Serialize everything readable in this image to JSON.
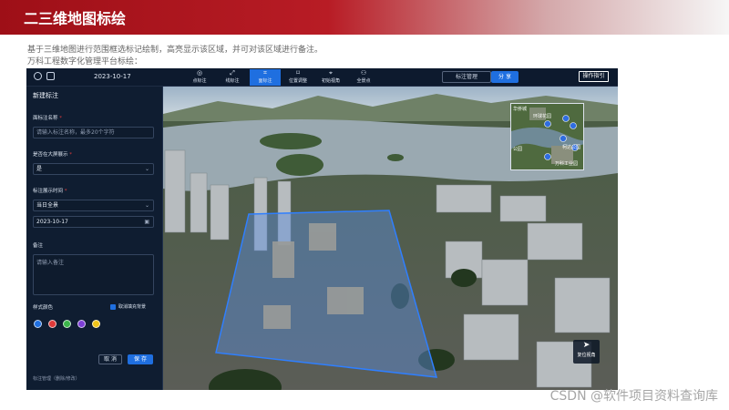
{
  "slide": {
    "title": "二三维地图标绘",
    "description_line1": "基于三维地图进行范围框选标记绘制，高亮显示该区域，并可对该区域进行备注。",
    "description_line2": "万科工程数字化管理平台标绘："
  },
  "topbar": {
    "date": "2023-10-17",
    "tools": [
      {
        "label": "点标注",
        "icon": "point-marker-icon",
        "glyph": "◎"
      },
      {
        "label": "线标注",
        "icon": "line-marker-icon",
        "glyph": "⤢"
      },
      {
        "label": "面标注",
        "icon": "area-marker-icon",
        "glyph": "⌗"
      },
      {
        "label": "位置调整",
        "icon": "position-adjust-icon",
        "glyph": "⌑"
      },
      {
        "label": "初始视角",
        "icon": "initial-view-icon",
        "glyph": "⌖"
      },
      {
        "label": "全景点",
        "icon": "panorama-point-icon",
        "glyph": "⚇"
      }
    ],
    "active_tool": "面标注",
    "manage_button": "标注管理",
    "share_button": "分 享",
    "guide_button": "操作指引"
  },
  "panel": {
    "title": "新建标注",
    "name_label": "面标注名称",
    "name_placeholder": "请输入标注名称，最多20个字符",
    "bigscreen_label": "是否在大屏展示",
    "bigscreen_value": "是",
    "time_label": "标注展示时间",
    "time_value": "当日全景",
    "date_value": "2023-10-17",
    "note_label": "备注",
    "note_placeholder": "请输入备注",
    "style_label": "样式颜色",
    "cancel_fill_label": "取消填充背景",
    "colors": [
      "#1f6fe0",
      "#e03a3a",
      "#3bb54a",
      "#7d3fd6",
      "#f0c419"
    ],
    "cancel_button": "取 消",
    "save_button": "保 存",
    "footer": "标注管理（删除/修改）"
  },
  "minimap": {
    "labels": [
      "华侨城",
      "环球花园",
      "柯达公园",
      "公园",
      "万科工业园"
    ],
    "pins": [
      "1",
      "2",
      "3",
      "4",
      "5",
      "6"
    ]
  },
  "reset_view_label": "复位视角",
  "watermark": "CSDN @软件项目资料查询库"
}
